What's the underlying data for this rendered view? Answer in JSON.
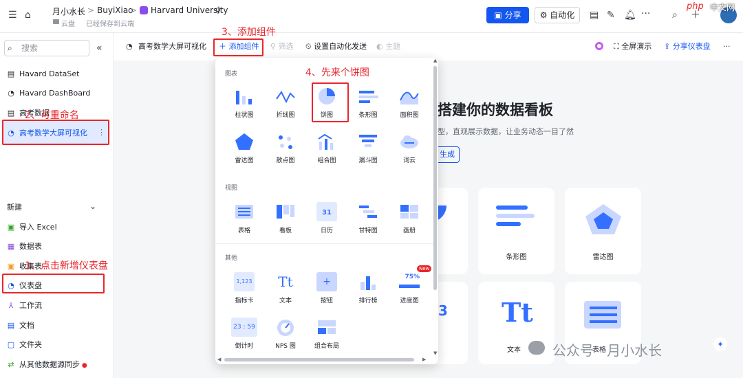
{
  "topbar": {
    "user": "月小水长",
    "crumb_sep": ">",
    "workspace": "BuyiXiao",
    "doc": "Harvard University",
    "location": "云盘",
    "save_status": "已经保存到云端",
    "share": "分享",
    "automation": "自动化",
    "php_badge": "php",
    "php_badge_cn": "中文网"
  },
  "sidebar": {
    "search_placeholder": "搜索",
    "collapse": "«",
    "items": [
      "Havard DataSet",
      "Havard DashBoard",
      "高考数据",
      "高考数学大屏可视化"
    ],
    "new_section": "新建",
    "new_items": [
      "导入 Excel",
      "数据表",
      "收集表",
      "仪表盘",
      "工作流",
      "文档",
      "文件夹",
      "从其他数据源同步"
    ]
  },
  "toolbar": {
    "title": "高考数学大屏可视化",
    "add_component": "添加组件",
    "filter": "筛选",
    "auto_send": "设置自动化发送",
    "theme": "主题",
    "fullscreen": "全屏演示",
    "share_dashboard": "分享仪表盘",
    "more": "···"
  },
  "annotations": [
    "3、添加组件",
    "4、先来个饼图",
    "2、可重命名",
    "1、点击新增仪表盘"
  ],
  "panel": {
    "sections": [
      "图表",
      "视图",
      "其他"
    ],
    "charts": [
      "柱状图",
      "折线图",
      "饼图",
      "条形图",
      "面积图",
      "雷达图",
      "散点图",
      "组合图",
      "漏斗图",
      "词云"
    ],
    "views": [
      "表格",
      "看板",
      "日历",
      "甘特图",
      "画册"
    ],
    "others": [
      "指标卡",
      "文本",
      "按钮",
      "排行榜",
      "进度图",
      "倒计时",
      "NPS 图",
      "组合布局"
    ],
    "metric_sample": "1,123",
    "progress_sample": "75%",
    "new_badge": "New",
    "countdown_sample": "23 : 59",
    "calendar_sample": "31"
  },
  "main": {
    "heading": "搭建你的数据看板",
    "desc": "型，直观展示数据，让业务动态一目了然",
    "generate": "生成",
    "cards": [
      "条形图",
      "雷达图",
      "文本",
      "表格"
    ],
    "number_card": "3"
  },
  "watermark": "公众号 · 月小水长"
}
